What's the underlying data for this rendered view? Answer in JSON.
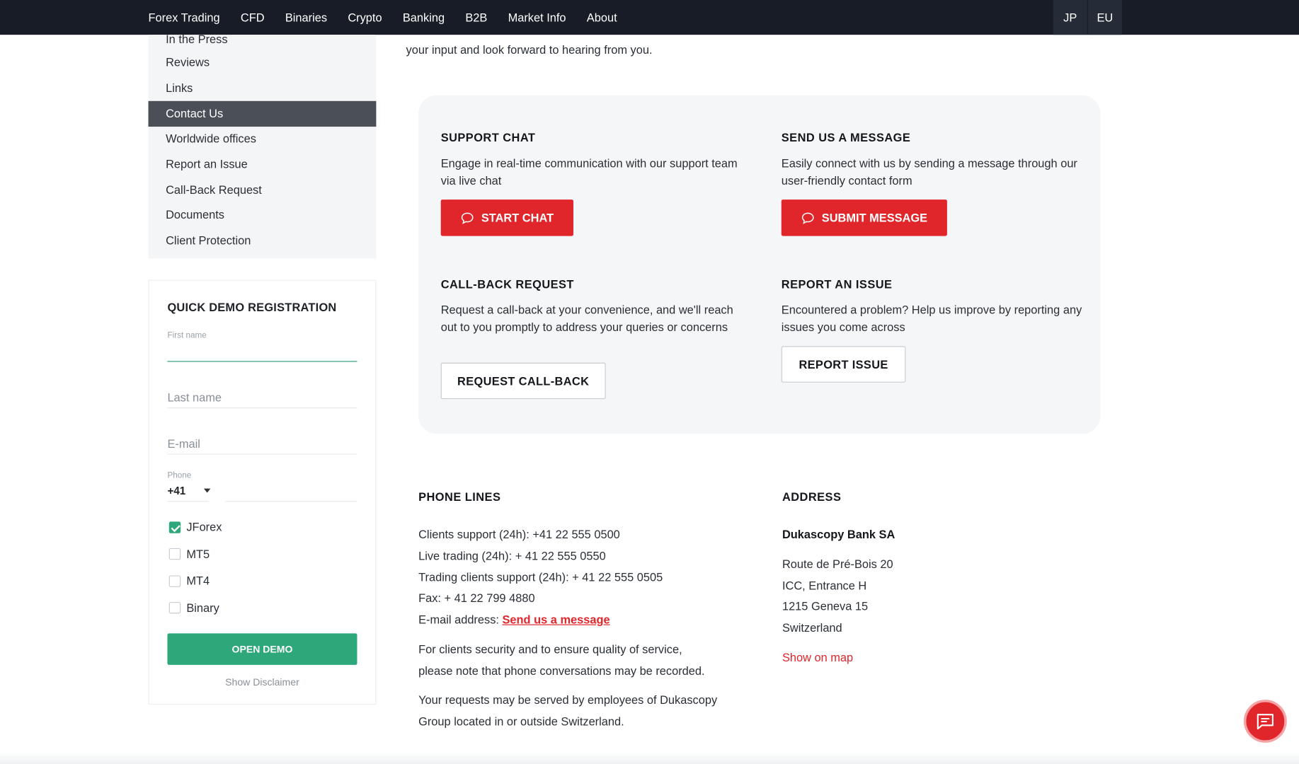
{
  "nav": {
    "items": [
      "Forex Trading",
      "CFD",
      "Binaries",
      "Crypto",
      "Banking",
      "B2B",
      "Market Info",
      "About"
    ],
    "regions": [
      "JP",
      "EU"
    ]
  },
  "sidebar": {
    "items": [
      "In the Press",
      "Reviews",
      "Links",
      "Contact Us",
      "Worldwide offices",
      "Report an Issue",
      "Call-Back Request",
      "Documents",
      "Client Protection"
    ],
    "active": "Contact Us"
  },
  "demo_form": {
    "title": "QUICK DEMO REGISTRATION",
    "first_name_label": "First name",
    "last_name_placeholder": "Last name",
    "email_placeholder": "E-mail",
    "phone_label": "Phone",
    "phone_code": "+41",
    "platforms": [
      {
        "label": "JForex",
        "checked": true
      },
      {
        "label": "MT5",
        "checked": false
      },
      {
        "label": "MT4",
        "checked": false
      },
      {
        "label": "Binary",
        "checked": false
      }
    ],
    "submit_label": "OPEN DEMO",
    "disclaimer_label": "Show Disclaimer"
  },
  "intro_text": "your input and look forward to hearing from you.",
  "contact_options": {
    "support_chat": {
      "title": "SUPPORT CHAT",
      "text": "Engage in real-time communication with our support team via live chat",
      "button": "START CHAT"
    },
    "send_message": {
      "title": "SEND US A MESSAGE",
      "text": "Easily connect with us by sending a message through our user-friendly contact form",
      "button": "SUBMIT MESSAGE"
    },
    "call_back": {
      "title": "CALL-BACK REQUEST",
      "text": "Request a call-back at your convenience, and we'll reach out to you promptly to address your queries or concerns",
      "button": "REQUEST CALL-BACK"
    },
    "report_issue": {
      "title": "REPORT AN ISSUE",
      "text": "Encountered a problem? Help us improve by reporting any issues you come across",
      "button": "REPORT ISSUE"
    }
  },
  "phone_lines": {
    "title": "PHONE LINES",
    "lines": [
      "Clients support (24h): +41 22 555 0500",
      "Live trading (24h): + 41 22 555 0550",
      "Trading clients support (24h): + 41 22 555 0505",
      "Fax: + 41 22 799 4880"
    ],
    "email_label": "E-mail address:",
    "email_link": "Send us a message",
    "note1_line1": "For clients security and to ensure quality of service,",
    "note1_line2": "please note that phone conversations may be recorded.",
    "note2_line1": "Your requests may be served by employees of Dukascopy",
    "note2_line2": "Group located in or outside Switzerland."
  },
  "address": {
    "title": "ADDRESS",
    "company": "Dukascopy Bank SA",
    "lines": [
      "Route de Pré-Bois 20",
      "ICC, Entrance H",
      "1215 Geneva 15",
      "Switzerland"
    ],
    "map_link": "Show on map"
  },
  "colors": {
    "nav_bg": "#171c26",
    "accent_red": "#e1262b",
    "accent_green": "#2ea77a",
    "sidebar_active": "#4b5058"
  }
}
